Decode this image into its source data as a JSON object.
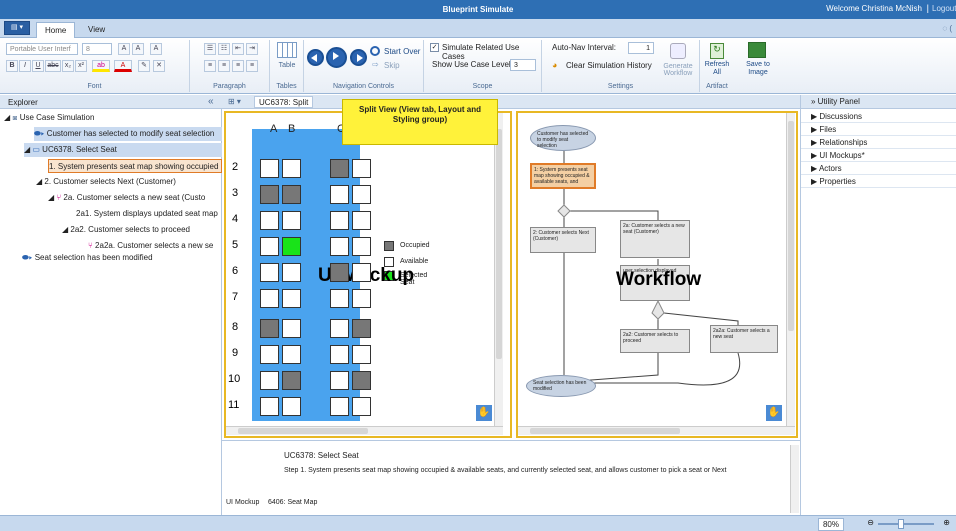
{
  "titlebar": {
    "app_title": "Blueprint Simulate",
    "welcome": "Welcome Christina McNish",
    "separator": "|",
    "logout": "Logout"
  },
  "tabs": [
    {
      "label": "Home",
      "active": true
    },
    {
      "label": "View",
      "active": false
    }
  ],
  "ribbon": {
    "font": {
      "family_placeholder": "Portable User Interf",
      "size": "8",
      "label": "Font",
      "format_buttons": [
        "B",
        "I",
        "U",
        "abc",
        "x₂",
        "x²"
      ]
    },
    "paragraph": {
      "label": "Paragraph"
    },
    "tables": {
      "button": "Table",
      "label": "Tables"
    },
    "navigation": {
      "start_over": "Start Over",
      "skip": "Skip",
      "label": "Navigation Controls"
    },
    "scope": {
      "simulate_related": "Simulate Related Use Cases",
      "simulate_checked": true,
      "show_level_label": "Show Use Case Level:",
      "show_level_value": "3",
      "label": "Scope"
    },
    "settings": {
      "auto_nav_label": "Auto-Nav Interval:",
      "auto_nav_value": "1",
      "clear_history": "Clear Simulation History",
      "generate_workflow": "Generate Workflow",
      "label": "Settings"
    },
    "artifact": {
      "refresh": "Refresh All",
      "save": "Save to Image",
      "label": "Artifact"
    }
  },
  "explorer": {
    "header": "Explorer",
    "collapse": "«",
    "nodes": [
      {
        "text": "Use Case Simulation",
        "indent": 0
      },
      {
        "text": "Customer has selected to modify seat selection",
        "indent": 1,
        "selected": true
      },
      {
        "text": "UC6378. Select Seat",
        "indent": 1,
        "selected": true
      },
      {
        "text": "1. System presents seat map showing occupied",
        "indent": 2,
        "highlight": true
      },
      {
        "text": "2. Customer selects Next (Customer)",
        "indent": 2
      },
      {
        "text": "2a. Customer selects a new seat (Custo",
        "indent": 3
      },
      {
        "text": "2a1. System displays updated seat map",
        "indent": 4
      },
      {
        "text": "2a2. Customer selects to proceed",
        "indent": 4
      },
      {
        "text": "2a2a. Customer selects a new se",
        "indent": 5
      },
      {
        "text": "Seat selection has been modified",
        "indent": 1
      }
    ]
  },
  "center": {
    "view_tab": "UC6378: Split",
    "callout": "Split View (View tab, Layout and Styling group)",
    "mockup_label": "UI Mockup",
    "workflow_label": "Workflow",
    "seat_cols": [
      "A",
      "B",
      "C"
    ],
    "rows": [
      "2",
      "3",
      "4",
      "5",
      "6",
      "7",
      "8",
      "9",
      "10",
      "11"
    ],
    "legend": [
      "Occupied",
      "Available",
      "Selected Seat"
    ],
    "workflow_nodes": [
      "Customer has selected to modify seat selection",
      "1: System presents seat map showing occupied & available seats, and",
      "2: Customer selects Next (Customer)",
      "2a: Customer selects a new seat (Customer)",
      "user selection displayed",
      "2a2: Customer selects to proceed",
      "2a2a: Customer selects a new seat",
      "Seat selection has been modified"
    ]
  },
  "bottom": {
    "title": "UC6378: Select Seat",
    "step": "Step 1. System presents seat map showing occupied & available seats, and currently selected seat, and allows customer to pick a seat or Next",
    "ui_mockup_label": "UI Mockup",
    "ui_mockup_value": "6406: Seat Map"
  },
  "utility": {
    "header": "Utility Panel",
    "items": [
      "Discussions",
      "Files",
      "Relationships",
      "UI Mockups*",
      "Actors",
      "Properties"
    ]
  },
  "status": {
    "zoom": "80%"
  }
}
